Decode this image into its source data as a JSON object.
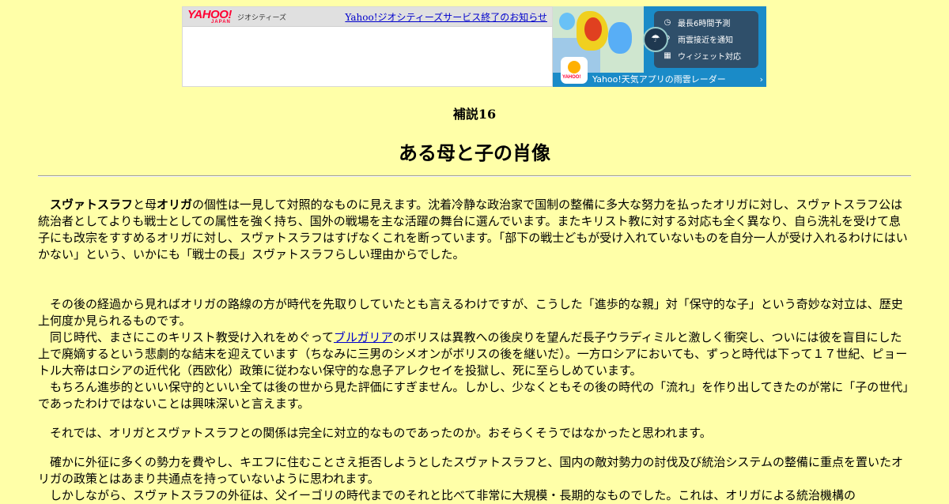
{
  "banner": {
    "logo_text": "YAHOO!",
    "logo_sub": "JAPAN",
    "service_name": "ジオシティーズ",
    "notice_link": "Yahoo!ジオシティーズサービス終了のお知らせ",
    "features": [
      {
        "icon": "clock-icon",
        "glyph": "◷",
        "label": "最長6時間予測"
      },
      {
        "icon": "pin-icon",
        "glyph": "⚲",
        "label": "雨雲接近を通知"
      },
      {
        "icon": "widget-icon",
        "glyph": "▦",
        "label": "ウィジェット対応"
      }
    ],
    "app_logo": "YAHOO!",
    "cta_label": "Yahoo!天気アプリの雨雲レーダー"
  },
  "article": {
    "subhead": "補説16",
    "title": "ある母と子の肖像",
    "p1_name1": "スヴァトスラフ",
    "p1_t1": "と母",
    "p1_name2": "オリガ",
    "p1_t2": "の個性は一見して対照的なものに見えます。沈着冷静な政治家で国制の整備に多大な努力を払ったオリガに対し、スヴァトスラフ公は統治者としてよりも戦士としての属性を強く持ち、国外の戦場を主な活躍の舞台に選んでいます。またキリスト教に対する対応も全く異なり、自ら洗礼を受けて息子にも改宗をすすめるオリガに対し、スヴァトスラフはすげなくこれを断っています。「部下の戦士どもが受け入れていないものを自分一人が受け入れるわけにはいかない」という、いかにも「戦士の長」スヴァトスラフらしい理由からでした。",
    "p2": "その後の経過から見ればオリガの路線の方が時代を先取りしていたとも言えるわけですが、こうした「進歩的な親」対「保守的な子」という奇妙な対立は、歴史上何度か見られるものです。",
    "p3_t1": "同じ時代、まさにこのキリスト教受け入れをめぐって",
    "p3_link": "ブルガリア",
    "p3_t2": "のボリスは異教への後戻りを望んだ長子ウラディミルと激しく衝突し、ついには彼を盲目にした上で廃嫡するという悲劇的な結末を迎えています（ちなみに三男のシメオンがボリスの後を継いだ）。一方ロシアにおいても、ずっと時代は下って１７世紀、ピョートル大帝はロシアの近代化（西欧化）政策に従わない保守的な息子アレクセイを投獄し、死に至らしめています。",
    "p4": "もちろん進歩的といい保守的といい全ては後の世から見た評価にすぎません。しかし、少なくともその後の時代の「流れ」を作り出してきたのが常に「子の世代」であったわけではないことは興味深いと言えます。",
    "p5": "それでは、オリガとスヴァトスラフとの関係は完全に対立的なものであったのか。おそらくそうではなかったと思われます。",
    "p6": "確かに外征に多くの勢力を費やし、キエフに住むことさえ拒否しようとしたスヴァトスラフと、国内の敵対勢力の討伐及び統治システムの整備に重点を置いたオリガの政策とはあまり共通点を持っていないように思われます。",
    "p7": "しかしながら、スヴァトスラフの外征は、父イーゴリの時代までのそれと比べて非常に大規模・長期的なものでした。これは、オリガによる統治機構の"
  }
}
